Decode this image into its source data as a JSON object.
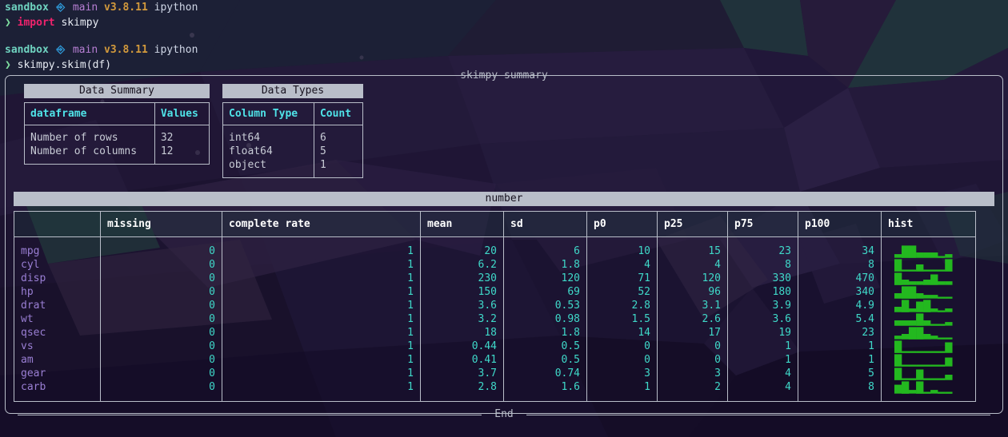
{
  "terminal": {
    "prompt1": {
      "host": "sandbox",
      "git_icon": "git-branch-icon",
      "branch": "main",
      "version": "v3.8.11",
      "env": "ipython"
    },
    "command1": {
      "arrow": "❯",
      "keyword": "import",
      "rest": " skimpy"
    },
    "prompt2": {
      "host": "sandbox",
      "git_icon": "git-branch-icon",
      "branch": "main",
      "version": "v3.8.11",
      "env": "ipython"
    },
    "command2": {
      "arrow": "❯",
      "text": "skimpy.skim(df)"
    }
  },
  "panel": {
    "title": "skimpy summary",
    "footer": "End"
  },
  "data_summary": {
    "caption": "Data Summary",
    "headers": [
      "dataframe",
      "Values"
    ],
    "rows": [
      [
        "Number of rows",
        "32"
      ],
      [
        "Number of columns",
        "12"
      ]
    ]
  },
  "data_types": {
    "caption": "Data Types",
    "headers": [
      "Column Type",
      "Count"
    ],
    "rows": [
      [
        "int64",
        "6"
      ],
      [
        "float64",
        "5"
      ],
      [
        "object",
        "1"
      ]
    ]
  },
  "number_section": {
    "banner": "number",
    "headers": [
      "",
      "missing",
      "complete rate",
      "mean",
      "sd",
      "p0",
      "p25",
      "p75",
      "p100",
      "hist"
    ],
    "rows": [
      {
        "name": "mpg",
        "missing": "0",
        "complete_rate": "1",
        "mean": "20",
        "sd": "6",
        "p0": "10",
        "p25": "15",
        "p75": "23",
        "p100": "34",
        "hist": "▂▇▇▃▃▃▁▂"
      },
      {
        "name": "cyl",
        "missing": "0",
        "complete_rate": "1",
        "mean": "6.2",
        "sd": "1.8",
        "p0": "4",
        "p25": "4",
        "p75": "8",
        "p100": "8",
        "hist": "▇▁▁▄▁▁▁▇"
      },
      {
        "name": "disp",
        "missing": "0",
        "complete_rate": "1",
        "mean": "230",
        "sd": "120",
        "p0": "71",
        "p25": "120",
        "p75": "330",
        "p100": "470",
        "hist": "▇▃▂▂▃▆▂▂"
      },
      {
        "name": "hp",
        "missing": "0",
        "complete_rate": "1",
        "mean": "150",
        "sd": "69",
        "p0": "52",
        "p25": "96",
        "p75": "180",
        "p100": "340",
        "hist": "▃▇▇▃▂▂▁▁"
      },
      {
        "name": "drat",
        "missing": "0",
        "complete_rate": "1",
        "mean": "3.6",
        "sd": "0.53",
        "p0": "2.8",
        "p25": "3.1",
        "p75": "3.9",
        "p100": "4.9",
        "hist": "▃▇▂▆▇▂▁▂"
      },
      {
        "name": "wt",
        "missing": "0",
        "complete_rate": "1",
        "mean": "3.2",
        "sd": "0.98",
        "p0": "1.5",
        "p25": "2.6",
        "p75": "3.6",
        "p100": "5.4",
        "hist": "▃▃▃▇▃▁▁▂"
      },
      {
        "name": "qsec",
        "missing": "0",
        "complete_rate": "1",
        "mean": "18",
        "sd": "1.8",
        "p0": "14",
        "p25": "17",
        "p75": "19",
        "p100": "23",
        "hist": "▂▃▇▇▃▂▁▁"
      },
      {
        "name": "vs",
        "missing": "0",
        "complete_rate": "1",
        "mean": "0.44",
        "sd": "0.5",
        "p0": "0",
        "p25": "0",
        "p75": "1",
        "p100": "1",
        "hist": "▇▁▁▁▁▁▁▆"
      },
      {
        "name": "am",
        "missing": "0",
        "complete_rate": "1",
        "mean": "0.41",
        "sd": "0.5",
        "p0": "0",
        "p25": "0",
        "p75": "1",
        "p100": "1",
        "hist": "▇▁▁▁▁▁▁▅"
      },
      {
        "name": "gear",
        "missing": "0",
        "complete_rate": "1",
        "mean": "3.7",
        "sd": "0.74",
        "p0": "3",
        "p25": "3",
        "p75": "4",
        "p100": "5",
        "hist": "▇▁▁▆▁▁▁▃"
      },
      {
        "name": "carb",
        "missing": "0",
        "complete_rate": "1",
        "mean": "2.8",
        "sd": "1.6",
        "p0": "1",
        "p25": "2",
        "p75": "4",
        "p100": "8",
        "hist": "▅▇▂▇▁▂▁▁"
      }
    ]
  },
  "colors": {
    "accent_cyan": "#4fe3e8",
    "value_teal": "#3fd9c9",
    "rowname_purple": "#9a7fd4",
    "hist_green": "#23b81f",
    "rule_gray": "#b9bec9",
    "banner_gray": "#b9bec9",
    "background": "#1b1033"
  }
}
